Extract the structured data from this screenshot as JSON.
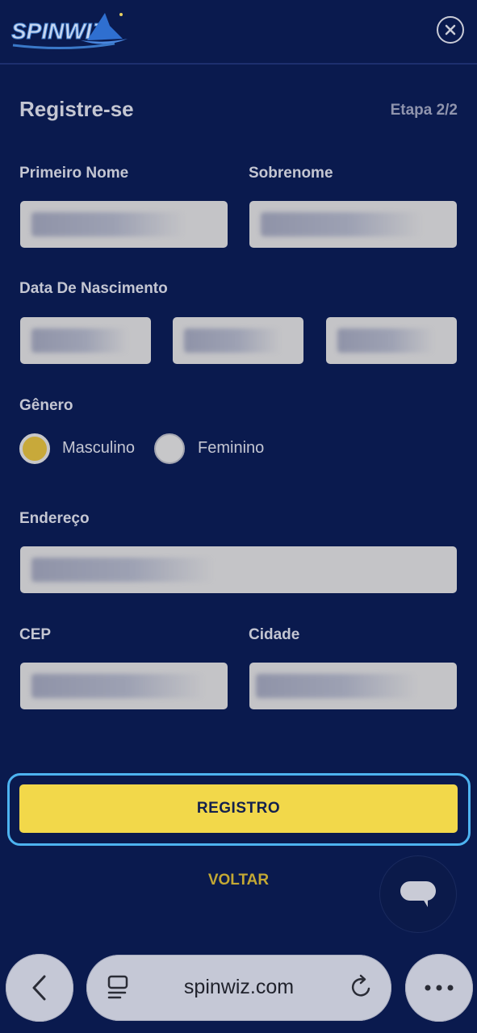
{
  "header": {
    "logo_text": "SPINWIZ",
    "close_label": "×"
  },
  "form": {
    "title": "Registre-se",
    "step": "Etapa 2/2",
    "first_name_label": "Primeiro Nome",
    "last_name_label": "Sobrenome",
    "dob_label": "Data De Nascimento",
    "gender_label": "Gênero",
    "gender_options": [
      {
        "label": "Masculino",
        "selected": true
      },
      {
        "label": "Feminino",
        "selected": false
      }
    ],
    "address_label": "Endereço",
    "cep_label": "CEP",
    "city_label": "Cidade",
    "submit_label": "REGISTRO",
    "back_label": "VOLTAR"
  },
  "browser": {
    "url": "spinwiz.com"
  },
  "colors": {
    "background": "#0a1a4e",
    "accent_yellow": "#f2d84a",
    "focus_outline": "#4db3f0",
    "field_bg": "#c4c4c7"
  },
  "icons": [
    "wizard-hat-icon",
    "close-icon",
    "chat-bubble-icon",
    "back-arrow-icon",
    "tabs-icon",
    "reload-icon",
    "more-icon"
  ]
}
